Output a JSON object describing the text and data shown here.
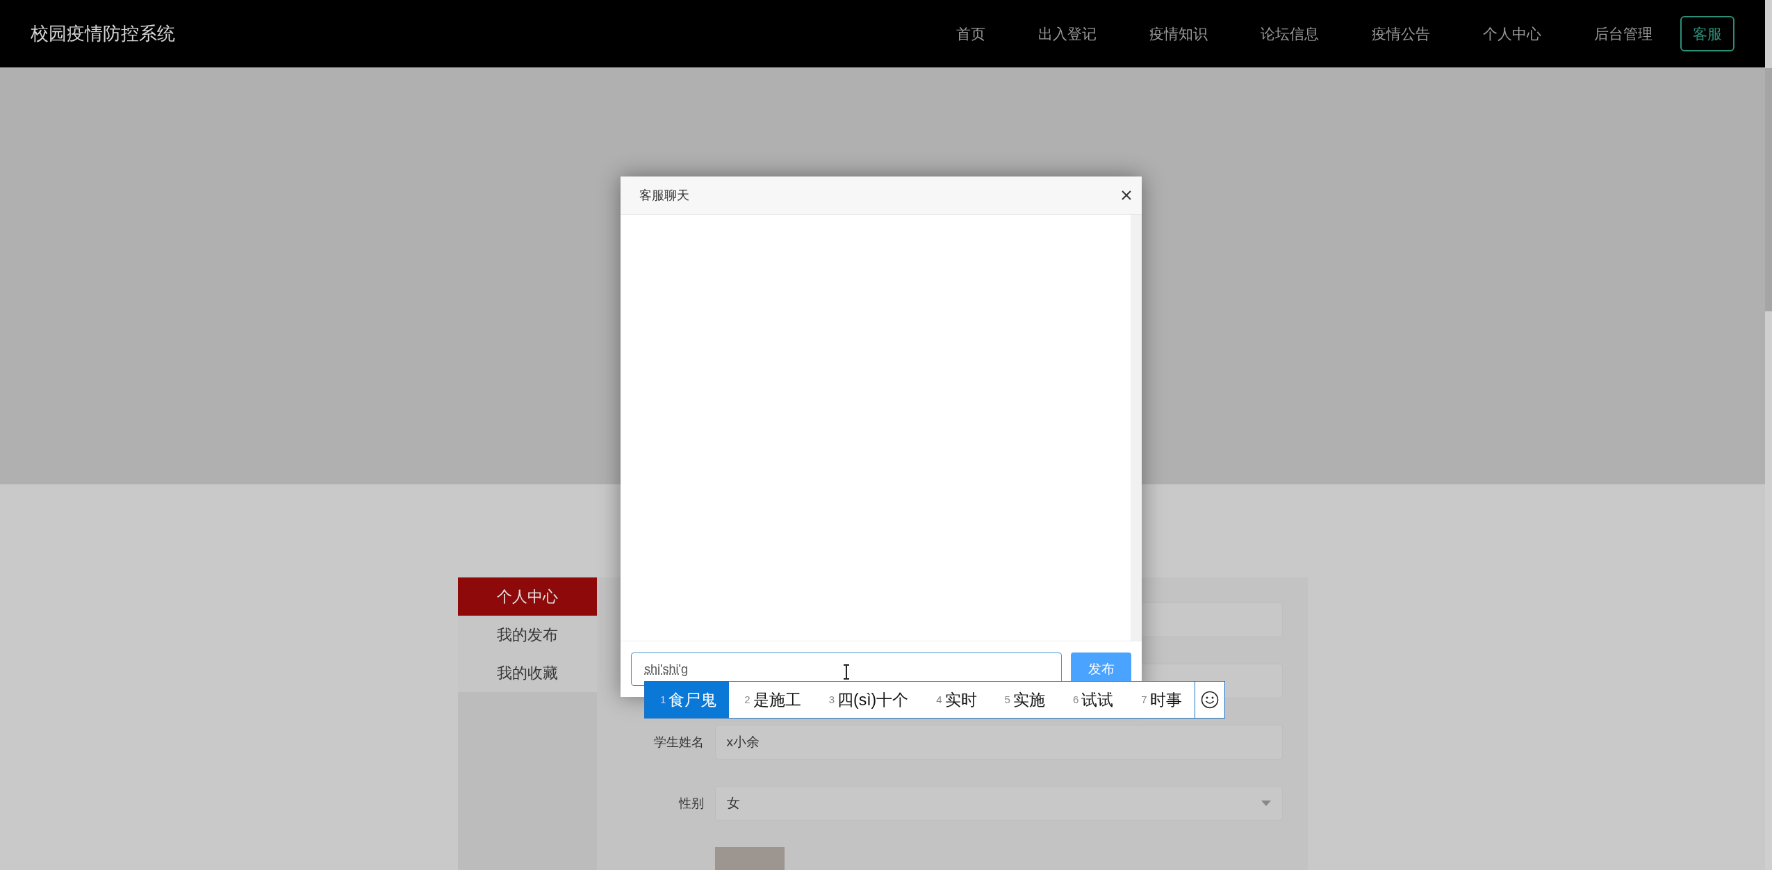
{
  "navbar": {
    "brand": "校园疫情防控系统",
    "links": [
      {
        "label": "首页"
      },
      {
        "label": "出入登记"
      },
      {
        "label": "疫情知识"
      },
      {
        "label": "论坛信息"
      },
      {
        "label": "疫情公告"
      },
      {
        "label": "个人中心"
      },
      {
        "label": "后台管理"
      }
    ],
    "button": "客服"
  },
  "sidebar": {
    "items": [
      {
        "label": "个人中心",
        "selected": true
      },
      {
        "label": "我的发布",
        "selected": false
      },
      {
        "label": "我的收藏",
        "selected": false
      }
    ]
  },
  "form": {
    "fields": [
      {
        "kind": "input"
      },
      {
        "kind": "input"
      },
      {
        "kind": "input",
        "label": "学生姓名",
        "value": "x小余"
      },
      {
        "kind": "select",
        "label": "性别",
        "value": "女"
      },
      {
        "kind": "photo"
      }
    ]
  },
  "chat_dialog": {
    "title": "客服聊天",
    "input_value": "shi'shi'g",
    "send_button": "发布"
  },
  "ime": {
    "candidates": [
      {
        "number": "1",
        "text": "食尸鬼",
        "selected": true
      },
      {
        "number": "2",
        "text": "是施工",
        "selected": false
      },
      {
        "number": "3",
        "text": "四(sì)十个",
        "selected": false
      },
      {
        "number": "4",
        "text": "实时",
        "selected": false
      },
      {
        "number": "5",
        "text": "实施",
        "selected": false
      },
      {
        "number": "6",
        "text": "试试",
        "selected": false
      },
      {
        "number": "7",
        "text": "时事",
        "selected": false
      }
    ]
  }
}
